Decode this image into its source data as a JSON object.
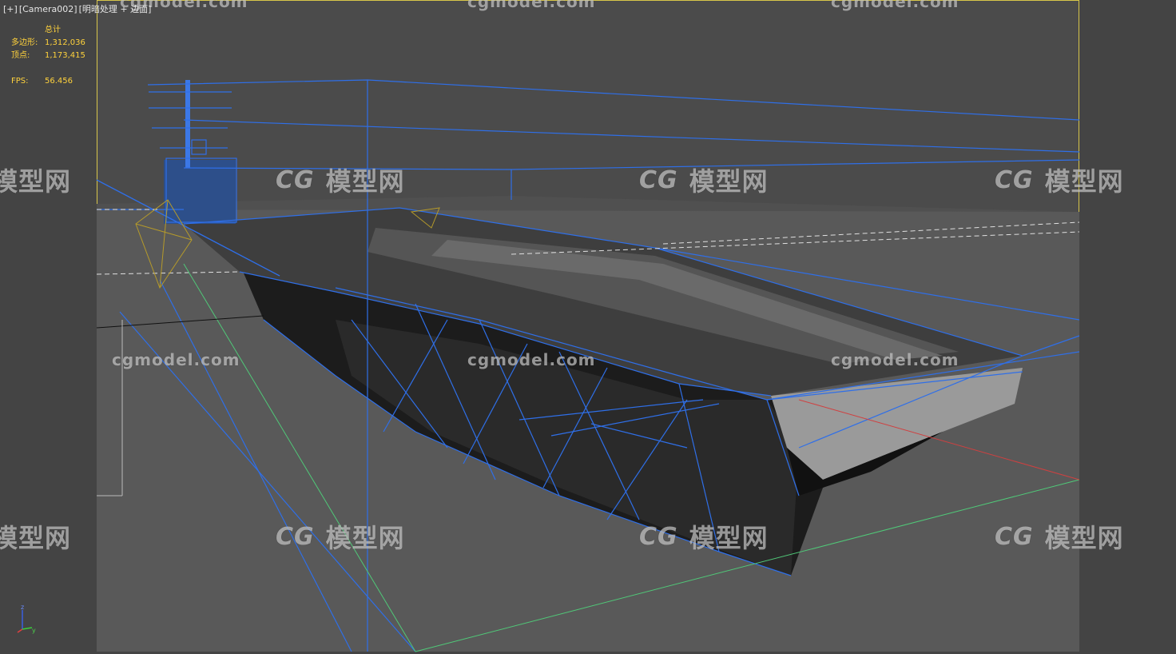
{
  "viewport": {
    "label_parts": [
      "[+]",
      "[Camera002]",
      "[明暗处理 + 边面]"
    ]
  },
  "stats": {
    "header": "总计",
    "polygons_label": "多边形:",
    "polygons_value": "1,312,036",
    "vertices_label": "顶点:",
    "vertices_value": "1,173,415",
    "fps_label": "FPS:",
    "fps_value": "56.456"
  },
  "watermark": {
    "url": "cgmodel.com",
    "cn_logo": "CG",
    "cn_text": "模型网"
  },
  "axis": {
    "z": "z",
    "y": "y",
    "x": "x"
  },
  "colors": {
    "viewport_bg": "#444444",
    "safe_frame": "#d8c64a",
    "wireframe": "#2f6fe8",
    "stats_text": "#ffd23c"
  }
}
